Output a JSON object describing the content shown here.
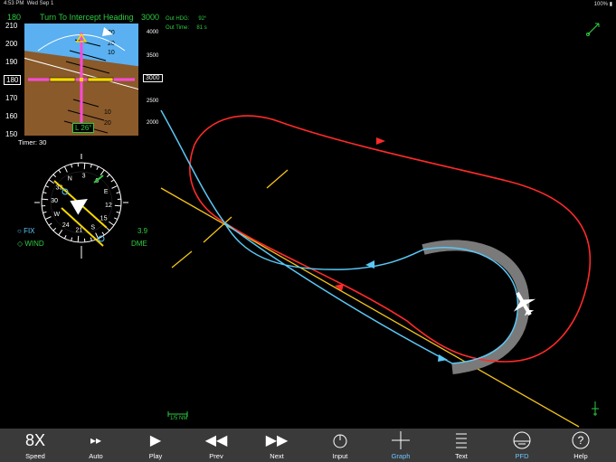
{
  "status": {
    "time": "4:53 PM",
    "date": "Wed Sep 1",
    "battery": "100%"
  },
  "pfd": {
    "title": "Turn To Intercept Heading",
    "heading_top": "180",
    "altitude_top": "3000",
    "speed_tape": [
      "210",
      "200",
      "190",
      "180",
      "170",
      "160",
      "150"
    ],
    "speed_current": "180",
    "alt_tape": [
      "4000",
      "3500",
      "3000",
      "2500",
      "2000"
    ],
    "alt_current": "3000",
    "bank_indicator": "L 26°",
    "pitch_marks": [
      "10",
      "20",
      "30",
      "10",
      "20",
      "30"
    ],
    "timer": "Timer: 30"
  },
  "info": {
    "out_hdg_label": "Out HDG:",
    "out_hdg_value": "92°",
    "out_time_label": "Out Time:",
    "out_time_value": "81 s"
  },
  "hsi": {
    "compass_labels": [
      "N",
      "3",
      "6",
      "E",
      "12",
      "15",
      "S",
      "21",
      "24",
      "W",
      "30",
      "33"
    ],
    "fix_label": "FIX",
    "wind_label": "WIND",
    "distance": "3.9",
    "dme_label": "DME"
  },
  "map": {
    "scale_label": "1/5 NM"
  },
  "colors": {
    "holding": "#ff2a2a",
    "track": "#5bc8f5",
    "radial": "#f5c518",
    "pfd_green": "#2ecc40",
    "active_tab": "#6ec6ff"
  },
  "toolbar": {
    "items": [
      {
        "label": "Speed",
        "icon": "speed-icon"
      },
      {
        "label": "Auto",
        "icon": "auto-icon"
      },
      {
        "label": "Play",
        "icon": "play-icon"
      },
      {
        "label": "Prev",
        "icon": "prev-icon"
      },
      {
        "label": "Next",
        "icon": "next-icon"
      },
      {
        "label": "Input",
        "icon": "input-icon"
      },
      {
        "label": "Graph",
        "icon": "graph-icon"
      },
      {
        "label": "Text",
        "icon": "text-icon"
      },
      {
        "label": "PFD",
        "icon": "pfd-icon"
      },
      {
        "label": "Help",
        "icon": "help-icon"
      }
    ]
  }
}
